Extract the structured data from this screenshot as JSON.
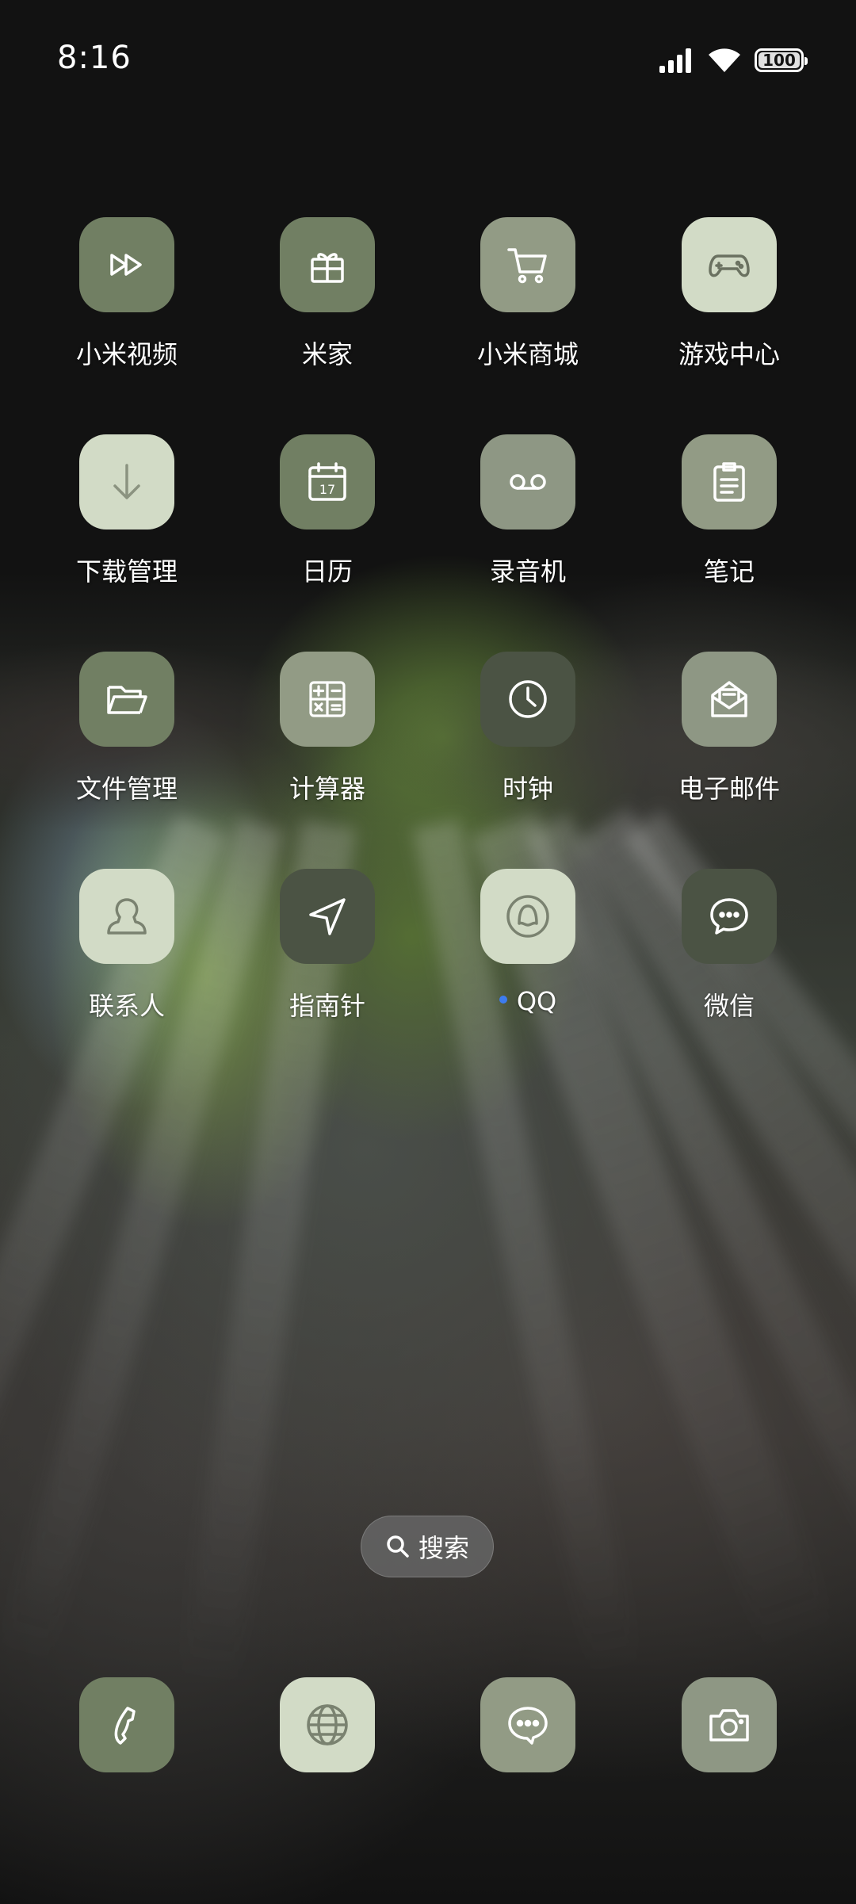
{
  "status_bar": {
    "time": "8:16",
    "battery": "100",
    "icons": [
      "signal-icon",
      "wifi-icon",
      "battery-icon"
    ]
  },
  "apps": [
    {
      "label": "小米视频",
      "icon": "fast-forward-icon",
      "color": "#717f63"
    },
    {
      "label": "米家",
      "icon": "gift-icon",
      "color": "#717f63"
    },
    {
      "label": "小米商城",
      "icon": "cart-icon",
      "color": "#929b85"
    },
    {
      "label": "游戏中心",
      "icon": "gamepad-icon",
      "color": "#d2dbc6"
    },
    {
      "label": "下载管理",
      "icon": "download-icon",
      "color": "#d2dbc6"
    },
    {
      "label": "日历",
      "icon": "calendar-icon",
      "calendar_day": "17",
      "color": "#717f63"
    },
    {
      "label": "录音机",
      "icon": "voicemail-icon",
      "color": "#8e9784"
    },
    {
      "label": "笔记",
      "icon": "clipboard-icon",
      "color": "#929b85"
    },
    {
      "label": "文件管理",
      "icon": "folder-icon",
      "color": "#717f63"
    },
    {
      "label": "计算器",
      "icon": "calculator-icon",
      "color": "#929b85"
    },
    {
      "label": "时钟",
      "icon": "clock-icon",
      "color": "#4b5344"
    },
    {
      "label": "电子邮件",
      "icon": "mail-icon",
      "color": "#8e9784"
    },
    {
      "label": "联系人",
      "icon": "contact-icon",
      "color": "#d2dbc6"
    },
    {
      "label": "指南针",
      "icon": "compass-icon",
      "color": "#4b5344"
    },
    {
      "label": "QQ",
      "icon": "qq-icon",
      "color": "#d2dbc6",
      "new_badge": true
    },
    {
      "label": "微信",
      "icon": "chat-bubble-icon",
      "color": "#4b5344"
    }
  ],
  "search": {
    "label": "搜索",
    "icon": "search-icon"
  },
  "dock": [
    {
      "icon": "phone-icon",
      "color": "#717f63"
    },
    {
      "icon": "globe-icon",
      "color": "#d2dbc6"
    },
    {
      "icon": "message-icon",
      "color": "#929b85"
    },
    {
      "icon": "camera-icon",
      "color": "#8e9784"
    }
  ],
  "colors": {
    "background": "#121212",
    "badge_dot": "#3d7cf0"
  }
}
